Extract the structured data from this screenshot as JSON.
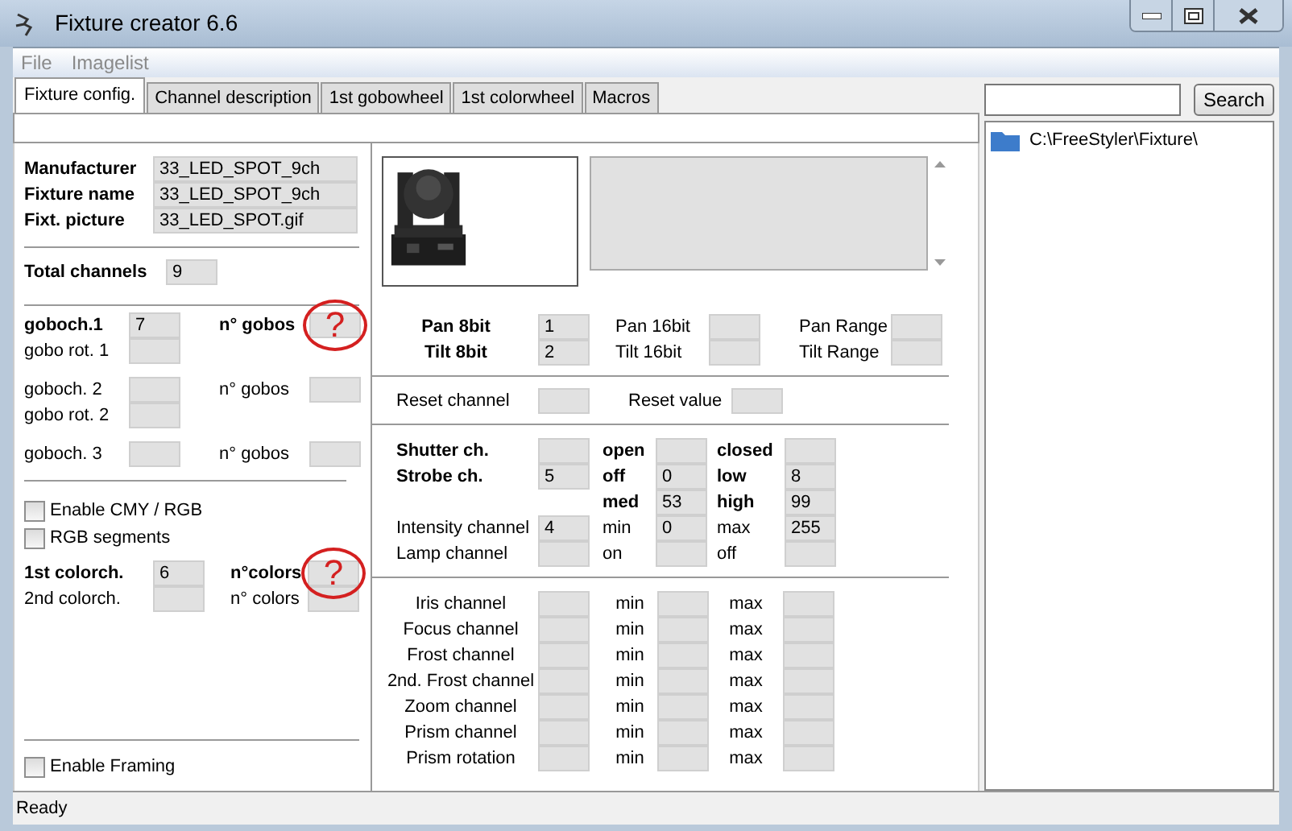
{
  "window": {
    "title": "Fixture creator 6.6"
  },
  "menu": [
    {
      "label": "File",
      "disabled": true
    },
    {
      "label": "Imagelist",
      "disabled": true
    }
  ],
  "tabs": [
    {
      "label": "Fixture config.",
      "selected": true
    },
    {
      "label": "Channel description",
      "selected": false
    },
    {
      "label": "1st gobowheel",
      "selected": false
    },
    {
      "label": "1st colorwheel",
      "selected": false
    },
    {
      "label": "Macros",
      "selected": false
    }
  ],
  "header_fields": [
    {
      "label": "Manufacturer",
      "value": "33_LED_SPOT_9ch"
    },
    {
      "label": "Fixture name",
      "value": "33_LED_SPOT_9ch"
    },
    {
      "label": "Fixt. picture",
      "value": "33_LED_SPOT.gif"
    }
  ],
  "total_channels": {
    "label": "Total channels",
    "value": "9"
  },
  "gobo_groups": [
    {
      "rows": [
        [
          {
            "label": "goboch.1",
            "bold": true,
            "value": "7"
          },
          {
            "label": "n° gobos",
            "bold": true,
            "annotation": "?"
          }
        ],
        [
          {
            "label": "gobo rot. 1"
          }
        ]
      ]
    },
    {
      "rows": [
        [
          {
            "label": "goboch. 2"
          },
          {
            "label": "n° gobos"
          }
        ],
        [
          {
            "label": "gobo rot. 2"
          }
        ]
      ]
    },
    {
      "rows": [
        [
          {
            "label": "goboch. 3"
          },
          {
            "label": "n° gobos"
          }
        ]
      ]
    }
  ],
  "color_options": [
    {
      "label": "Enable CMY / RGB",
      "checked": false
    },
    {
      "label": "RGB segments",
      "checked": false
    }
  ],
  "color_rows": [
    [
      {
        "label": "1st colorch.",
        "bold": true,
        "value": "6"
      },
      {
        "label": "n°colors",
        "bold": true,
        "annotation": "?"
      }
    ],
    [
      {
        "label": "2nd colorch."
      },
      {
        "label": "n° colors"
      }
    ]
  ],
  "framing": {
    "label": "Enable Framing",
    "checked": false
  },
  "middle_sections": [
    {
      "rows": [
        [
          {
            "label": "Pan 8bit",
            "bold": true,
            "value": "1"
          },
          {
            "label": "Pan 16bit"
          },
          {
            "label": "Pan Range"
          }
        ],
        [
          {
            "label": "Tilt 8bit",
            "bold": true,
            "value": "2"
          },
          {
            "label": "Tilt 16bit"
          },
          {
            "label": "Tilt Range"
          }
        ]
      ]
    },
    {
      "rows": [
        [
          {
            "label": "Reset channel"
          },
          {
            "label": "Reset value"
          }
        ]
      ]
    },
    {
      "rows": [
        [
          {
            "label": "Shutter ch.",
            "bold": true
          },
          {
            "label": "open",
            "bold": true
          },
          {
            "label": "closed",
            "bold": true
          }
        ],
        [
          {
            "label": "Strobe ch.",
            "bold": true,
            "value": "5"
          },
          {
            "label": "off",
            "bold": true,
            "value": "0"
          },
          {
            "label": "low",
            "bold": true,
            "value": "8"
          }
        ],
        [
          {
            "kind": "gap"
          },
          {
            "label": "med",
            "bold": true,
            "value": "53"
          },
          {
            "label": "high",
            "bold": true,
            "value": "99"
          }
        ],
        [
          {
            "label": "Intensity channel",
            "value": "4"
          },
          {
            "label": "min",
            "value": "0"
          },
          {
            "label": "max",
            "value": "255"
          }
        ],
        [
          {
            "label": "Lamp channel"
          },
          {
            "label": "on"
          },
          {
            "label": "off"
          }
        ]
      ]
    },
    {
      "rows": [
        [
          {
            "label": "Iris channel"
          },
          {
            "label": "min"
          },
          {
            "label": "max"
          }
        ],
        [
          {
            "label": "Focus channel"
          },
          {
            "label": "min"
          },
          {
            "label": "max"
          }
        ],
        [
          {
            "label": "Frost channel"
          },
          {
            "label": "min"
          },
          {
            "label": "max"
          }
        ],
        [
          {
            "label": "2nd. Frost channel"
          },
          {
            "label": "min"
          },
          {
            "label": "max"
          }
        ],
        [
          {
            "label": "Zoom channel"
          },
          {
            "label": "min"
          },
          {
            "label": "max"
          }
        ],
        [
          {
            "label": "Prism channel"
          },
          {
            "label": "min"
          },
          {
            "label": "max"
          }
        ],
        [
          {
            "label": "Prism rotation"
          },
          {
            "label": "min"
          },
          {
            "label": "max"
          }
        ]
      ]
    }
  ],
  "search": {
    "button": "Search"
  },
  "tree": [
    {
      "label": "C:\\FreeStyler\\Fixture\\"
    }
  ],
  "status_bar": "Ready"
}
